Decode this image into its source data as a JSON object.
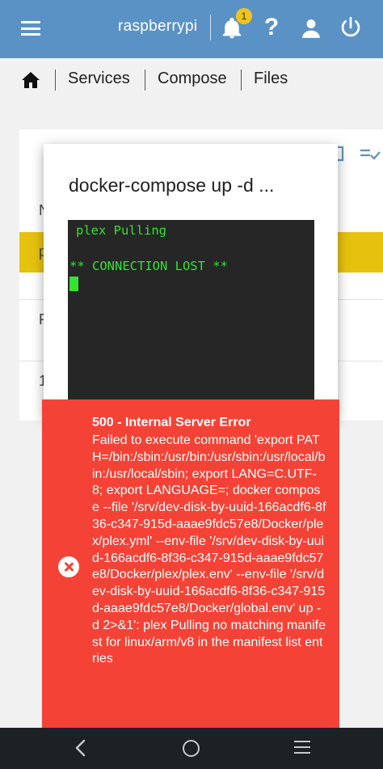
{
  "topbar": {
    "hostname": "raspberrypi",
    "notification_count": "1",
    "help_glyph": "?",
    "icons": [
      "menu-icon",
      "bell-icon",
      "help-icon",
      "user-icon",
      "power-icon"
    ],
    "color": "#5b92c6"
  },
  "breadcrumb": {
    "items": [
      "Services",
      "Compose",
      "Files"
    ]
  },
  "background_list": {
    "rows": [
      "N",
      "p",
      "P",
      "1"
    ],
    "selected_color": "#e6c20f"
  },
  "dialog": {
    "title": "docker-compose up -d ...",
    "terminal_lines": [
      "plex Pulling",
      "** CONNECTION LOST **"
    ],
    "terminal_text_color": "#32e332"
  },
  "error": {
    "title": "500 - Internal Server Error",
    "message": "Failed to execute command 'export PATH=/bin:/sbin:/usr/bin:/usr/sbin:/usr/local/bin:/usr/local/sbin; export LANG=C.UTF-8; export LANGUAGE=; docker compose --file '/srv/dev-disk-by-uuid-166acdf6-8f36-c347-915d-aaae9fdc57e8/Docker/plex/plex.yml' --env-file '/srv/dev-disk-by-uuid-166acdf6-8f36-c347-915d-aaae9fdc57e8/Docker/plex/plex.env' --env-file '/srv/dev-disk-by-uuid-166acdf6-8f36-c347-915d-aaae9fdc57e8/Docker/global.env' up -d 2>&1': plex Pulling no matching manifest for linux/arm/v8 in the manifest list entries",
    "color": "#f44336"
  },
  "navbar": {
    "icons": [
      "back-icon",
      "home-circle-icon",
      "recents-icon"
    ]
  }
}
